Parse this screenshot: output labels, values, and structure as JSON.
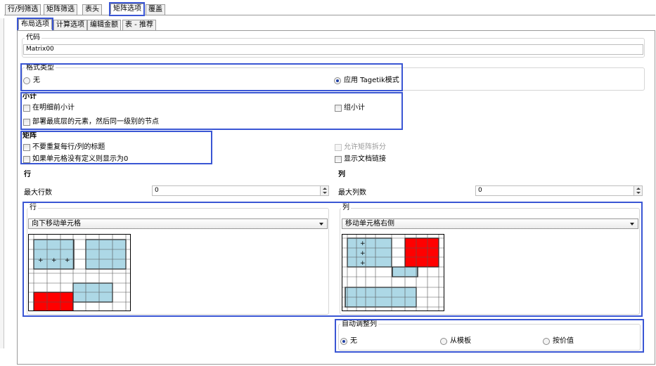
{
  "top_tabs": [
    "行/列筛选",
    "矩阵筛选",
    "表头",
    "矩阵选项",
    "覆盖"
  ],
  "sub_tabs": [
    "布局选项",
    "计算选项",
    "编辑金额",
    "表 - 推荐"
  ],
  "code": {
    "label": "代码",
    "value": "Matrix00"
  },
  "format_type": {
    "title": "格式类型",
    "opt_none": "无",
    "opt_tagetik": "应用 Tagetik模式"
  },
  "subtotal": {
    "title": "小计",
    "before_detail": "在明细前小计",
    "group_subtotal": "组小计",
    "deploy_bottom": "部署最底层的元素，然后同一级别的节点"
  },
  "matrix": {
    "title": "矩阵",
    "no_repeat_headers": "不要重复每行/列的标题",
    "show_zero": "如果单元格没有定义则显示为0",
    "allow_split": "允许矩阵拆分",
    "show_doc_link": "显示文档链接"
  },
  "rows": {
    "header": "行",
    "max_label": "最大行数",
    "max_value": "0",
    "group_title": "行",
    "move_option": "向下移动单元格"
  },
  "cols": {
    "header": "列",
    "max_label": "最大列数",
    "max_value": "0",
    "group_title": "列",
    "move_option": "移动单元格右侧"
  },
  "auto_adjust": {
    "title": "自动调整列",
    "opt_none": "无",
    "opt_template": "从模板",
    "opt_value": "按价值"
  },
  "colors": {
    "highlight": "#3a56d4",
    "cell_blue": "#add8e6",
    "cell_red": "#ff0000"
  }
}
